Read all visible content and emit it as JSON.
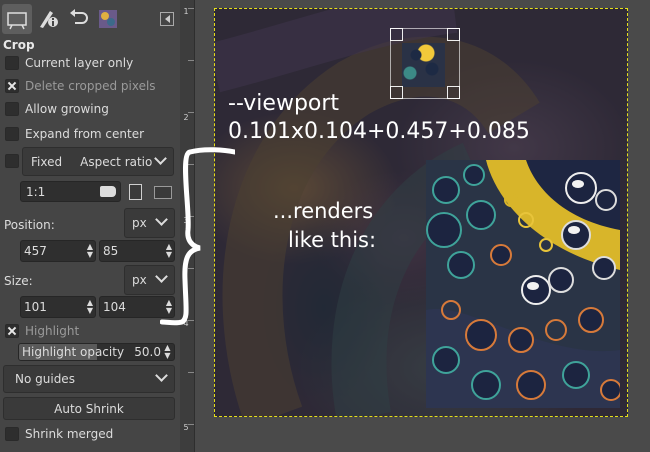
{
  "panel": {
    "title": "Crop",
    "options": {
      "current_layer_only": "Current layer only",
      "delete_cropped_pixels": "Delete cropped pixels",
      "allow_growing": "Allow growing",
      "expand_from_center": "Expand from center"
    },
    "fixed": {
      "label": "Fixed",
      "mode": "Aspect ratio",
      "ratio_value": "1:1"
    },
    "position": {
      "label": "Position:",
      "unit": "px",
      "x": "457",
      "y": "85"
    },
    "size": {
      "label": "Size:",
      "unit": "px",
      "w": "101",
      "h": "104"
    },
    "highlight": {
      "label": "Highlight"
    },
    "highlight_opacity": {
      "label": "Highlight opacity",
      "value": "50.0"
    },
    "guides": {
      "selected": "No guides"
    },
    "auto_shrink": "Auto Shrink",
    "shrink_merged": "Shrink merged"
  },
  "tabs": [
    {
      "name": "tool-options-tab",
      "icon": "tool-options-icon"
    },
    {
      "name": "device-status-tab",
      "icon": "device-status-icon"
    },
    {
      "name": "undo-history-tab",
      "icon": "undo-history-icon"
    },
    {
      "name": "images-tab",
      "icon": "image-thumbnail-icon"
    }
  ],
  "ruler": {
    "labels": [
      "1",
      "2",
      "3",
      "4",
      "5"
    ]
  },
  "overlay": {
    "viewport_line1": "--viewport",
    "viewport_line2": "0.101x0.104+0.457+0.085",
    "renders_line1": "...renders",
    "renders_line2": "like this:"
  },
  "colors": {
    "highlight_border": "#e6e01a",
    "panel_bg": "#454545",
    "canvas_bg": "#4a4a4a"
  }
}
